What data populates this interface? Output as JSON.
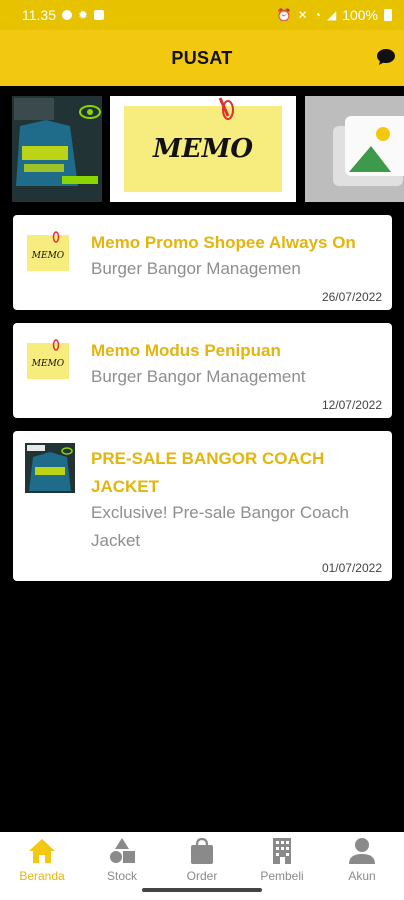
{
  "status_bar": {
    "time": "11.35",
    "battery": "100%"
  },
  "app_bar": {
    "title": "PUSAT"
  },
  "carousel": {
    "memo_text": "MEMO"
  },
  "posts": [
    {
      "title": "Memo Promo Shopee Always On",
      "subtitle": "Burger Bangor Managemen",
      "date": "26/07/2022",
      "thumb_text": "MEMO"
    },
    {
      "title": "Memo Modus Penipuan",
      "subtitle": "Burger Bangor Management",
      "date": "12/07/2022",
      "thumb_text": "MEMO"
    },
    {
      "title": "PRE-SALE BANGOR COACH JACKET",
      "subtitle": "Exclusive! Pre-sale Bangor Coach Jacket",
      "date": "01/07/2022"
    }
  ],
  "bottom_nav": [
    {
      "label": "Beranda",
      "icon": "home-icon",
      "active": true
    },
    {
      "label": "Stock",
      "icon": "shapes-icon"
    },
    {
      "label": "Order",
      "icon": "shopping-bag-icon"
    },
    {
      "label": "Pembeli",
      "icon": "building-icon"
    },
    {
      "label": "Akun",
      "icon": "person-icon"
    }
  ],
  "colors": {
    "accent": "#f2c811",
    "title_text": "#e2b60e",
    "muted": "#8e8e8e",
    "background": "#000000"
  }
}
